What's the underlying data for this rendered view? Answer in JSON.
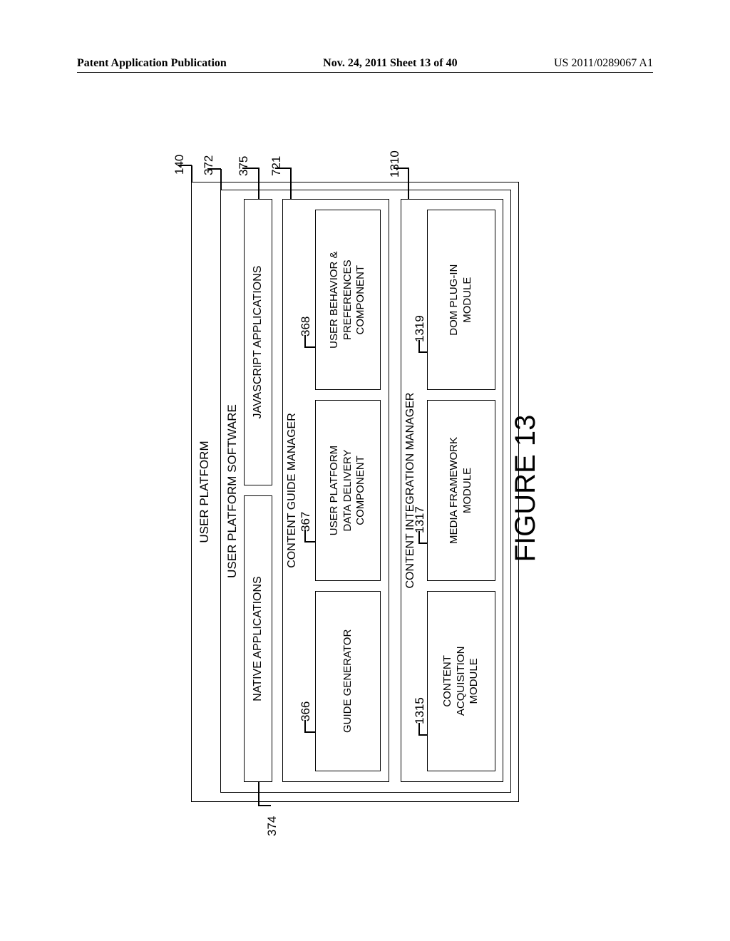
{
  "header": {
    "left": "Patent Application Publication",
    "middle": "Nov. 24, 2011  Sheet 13 of 40",
    "right": "US 2011/0289067 A1"
  },
  "figure": {
    "title": "FIGURE 13",
    "user_platform": "USER PLATFORM",
    "user_platform_software": "USER PLATFORM SOFTWARE",
    "native_apps": "NATIVE APPLICATIONS",
    "js_apps": "JAVASCRIPT APPLICATIONS",
    "content_guide_manager": "CONTENT GUIDE MANAGER",
    "guide_generator": "GUIDE GENERATOR",
    "data_delivery": "USER PLATFORM\nDATA DELIVERY\nCOMPONENT",
    "user_behavior": "USER BEHAVIOR &\nPREFERENCES\nCOMPONENT",
    "content_integration_manager": "CONTENT INTEGRATION MANAGER",
    "content_acquisition": "CONTENT\nACQUISITION\nMODULE",
    "media_framework": "MEDIA FRAMEWORK\nMODULE",
    "dom_plugin": "DOM PLUG-IN\nMODULE"
  },
  "refs": {
    "n140": "140",
    "n372": "372",
    "n374": "374",
    "n375": "375",
    "n721": "721",
    "n366": "366",
    "n367": "367",
    "n368": "368",
    "n1310": "1310",
    "n1315": "1315",
    "n1317": "1317",
    "n1319": "1319"
  }
}
